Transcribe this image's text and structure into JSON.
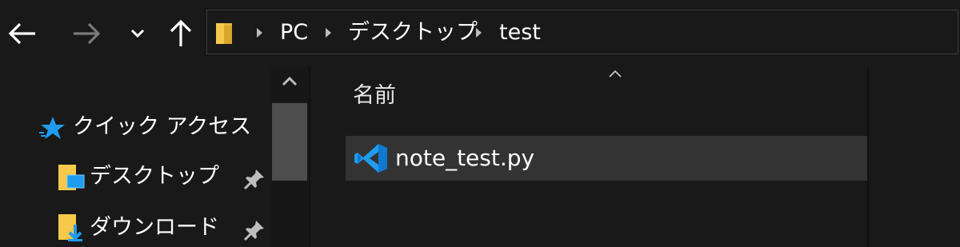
{
  "nav": {
    "back_icon": "arrow-left-icon",
    "forward_icon": "arrow-right-icon",
    "recent_icon": "chevron-down-icon",
    "up_icon": "arrow-up-icon"
  },
  "address_bar": {
    "folder_icon": "folder-icon",
    "crumbs": [
      "PC",
      "デスクトップ",
      "test"
    ]
  },
  "sidebar": {
    "items": [
      {
        "label": "クイック アクセス",
        "icon": "star-icon"
      },
      {
        "label": "デスクトップ",
        "icon": "desktop-folder-icon",
        "pinned": true
      },
      {
        "label": "ダウンロード",
        "icon": "downloads-folder-icon",
        "pinned": true
      }
    ]
  },
  "content": {
    "column_header": "名前",
    "files": [
      {
        "name": "note_test.py",
        "icon": "vscode-icon",
        "selected": true
      }
    ]
  },
  "colors": {
    "background": "#191919",
    "selected_row": "#333333",
    "folder_yellow": "#f6c94a",
    "accent_blue": "#1f9cf0"
  }
}
